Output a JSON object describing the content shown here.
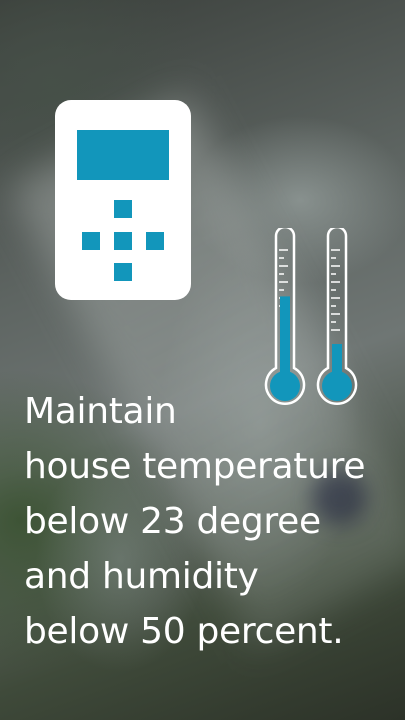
{
  "colors": {
    "accent": "#1296bb",
    "icon_fill": "#ffffff",
    "text": "#ffffff"
  },
  "icons": {
    "device": "thermostat-control-icon",
    "thermometer_left": "thermometer-icon",
    "thermometer_right": "thermometer-icon"
  },
  "thermometers": [
    {
      "level": 0.6
    },
    {
      "level": 0.25
    }
  ],
  "message": {
    "lines": [
      "Maintain",
      "house temperature",
      "below 23 degree",
      "and humidity",
      "below 50 percent."
    ]
  }
}
